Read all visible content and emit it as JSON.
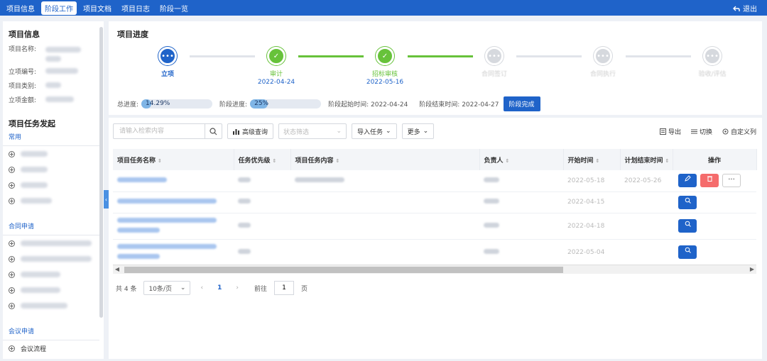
{
  "nav": {
    "tabs": [
      {
        "label": "项目信息",
        "active": false
      },
      {
        "label": "阶段工作",
        "active": true
      },
      {
        "label": "项目文档",
        "active": false
      },
      {
        "label": "项目日志",
        "active": false
      },
      {
        "label": "阶段一览",
        "active": false
      }
    ],
    "logout_label": "退出"
  },
  "sidebar": {
    "info_title": "项目信息",
    "fields": [
      {
        "label": "项目名称:"
      },
      {
        "label": "立项编号:"
      },
      {
        "label": "项目类别:"
      },
      {
        "label": "立项金额:"
      }
    ],
    "task_title": "项目任务发起",
    "groups": [
      {
        "title": "常用",
        "item_count": 4
      },
      {
        "title": "合同申请",
        "item_count": 5
      },
      {
        "title": "会议申请",
        "items": [
          "会议流程"
        ]
      }
    ]
  },
  "progress": {
    "title": "项目进度",
    "steps": [
      {
        "label": "立项",
        "date": "",
        "state": "current"
      },
      {
        "label": "审计",
        "date": "2022-04-24",
        "state": "done"
      },
      {
        "label": "招标审核",
        "date": "2022-05-16",
        "state": "done"
      },
      {
        "label": "合同签订",
        "date": "",
        "state": "todo"
      },
      {
        "label": "合同执行",
        "date": "",
        "state": "todo"
      },
      {
        "label": "验收/评估",
        "date": "",
        "state": "todo"
      }
    ],
    "total_label": "总进度:",
    "total_value": "14.29%",
    "total_fraction": 0.1429,
    "stage_label": "阶段进度:",
    "stage_value": "25%",
    "stage_fraction": 0.25,
    "start_label": "阶段起始时间: 2022-04-24",
    "end_label": "阶段结束时间: 2022-04-27",
    "complete_button": "阶段完成"
  },
  "tasks": {
    "search_placeholder": "请输入检索内容",
    "advanced_search": "高级查询",
    "status_placeholder": "状态筛选",
    "import_label": "导入任务",
    "more_label": "更多",
    "export_label": "导出",
    "switch_label": "切换",
    "custom_columns_label": "自定义列",
    "columns": [
      "项目任务名称",
      "任务优先级",
      "项目任务内容",
      "负责人",
      "开始时间",
      "计划结束时间",
      "操作"
    ],
    "rows": [
      {
        "start": "2022-05-18",
        "end": "2022-05-26",
        "ops": "edit"
      },
      {
        "start": "2022-04-15",
        "end": "",
        "ops": "view"
      },
      {
        "start": "2022-04-18",
        "end": "",
        "ops": "view"
      },
      {
        "start": "2022-05-04",
        "end": "",
        "ops": "view"
      }
    ]
  },
  "pager": {
    "total": "共 4 条",
    "page_size": "10条/页",
    "current": "1",
    "goto_label": "前往",
    "goto_value": "1",
    "page_suffix": "页"
  },
  "colors": {
    "primary": "#1f63c9",
    "success": "#67c23a",
    "danger": "#f56c6c"
  }
}
